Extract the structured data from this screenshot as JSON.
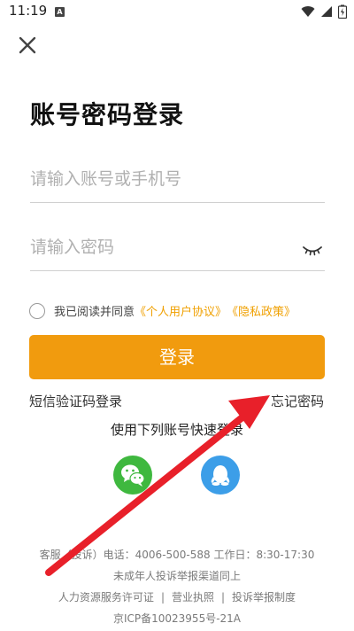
{
  "status_bar": {
    "time": "11:19",
    "badge": "A"
  },
  "login": {
    "title": "账号密码登录",
    "account_placeholder": "请输入账号或手机号",
    "password_placeholder": "请输入密码",
    "agree_text": "我已阅读并同意",
    "user_agreement": "《个人用户协议》",
    "privacy_policy": "《隐私政策》",
    "login_button": "登录",
    "sms_login": "短信验证码登录",
    "forgot_password": "忘记密码",
    "quick_login": "使用下列账号快速登录"
  },
  "footer": {
    "service": "客服（投诉）电话：4006-500-588 工作日：8:30-17:30",
    "minor_report": "未成年人投诉举报渠道同上",
    "license": "人力资源服务许可证",
    "business_license": "营业执照",
    "report_system": "投诉举报制度",
    "separator": "|",
    "icp": "京ICP备10023955号-21A"
  },
  "icons": {
    "close": "close-icon",
    "eye": "eye-closed-icon",
    "wechat": "wechat-icon",
    "qq": "qq-icon"
  },
  "colors": {
    "accent": "#f19b0e",
    "link": "#f0a000",
    "annotation_arrow": "#e8202a"
  }
}
